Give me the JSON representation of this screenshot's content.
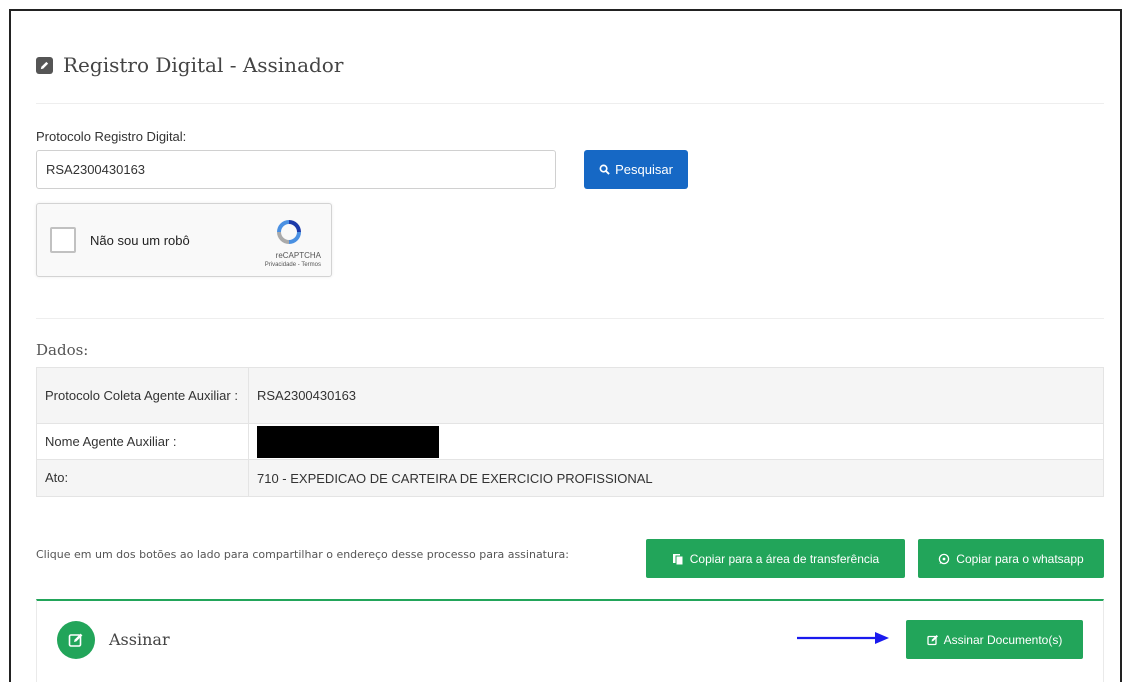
{
  "header": {
    "title": "Registro Digital - Assinador"
  },
  "search": {
    "label": "Protocolo Registro Digital:",
    "value": "RSA2300430163",
    "button_label": "Pesquisar"
  },
  "recaptcha": {
    "label": "Não sou um robô",
    "brand": "reCAPTCHA",
    "links": "Privacidade - Termos"
  },
  "dados": {
    "title": "Dados:",
    "rows": [
      {
        "key": "Protocolo Coleta Agente Auxiliar :",
        "value": "RSA2300430163"
      },
      {
        "key": "Nome Agente Auxiliar :",
        "value": ""
      },
      {
        "key": "Ato:",
        "value": "710 - EXPEDICAO DE CARTEIRA DE EXERCICIO PROFISSIONAL"
      }
    ]
  },
  "share": {
    "text": "Clique em um dos botões ao lado para compartilhar o endereço desse processo para assinatura:",
    "copy_label": "Copiar para a área de transferência",
    "whatsapp_label": "Copiar para o whatsapp"
  },
  "sign": {
    "title": "Assinar",
    "button_label": "Assinar Documento(s)"
  },
  "colors": {
    "primary_blue": "#1668c5",
    "success_green": "#22a55a",
    "arrow_blue": "#1a1aee"
  }
}
